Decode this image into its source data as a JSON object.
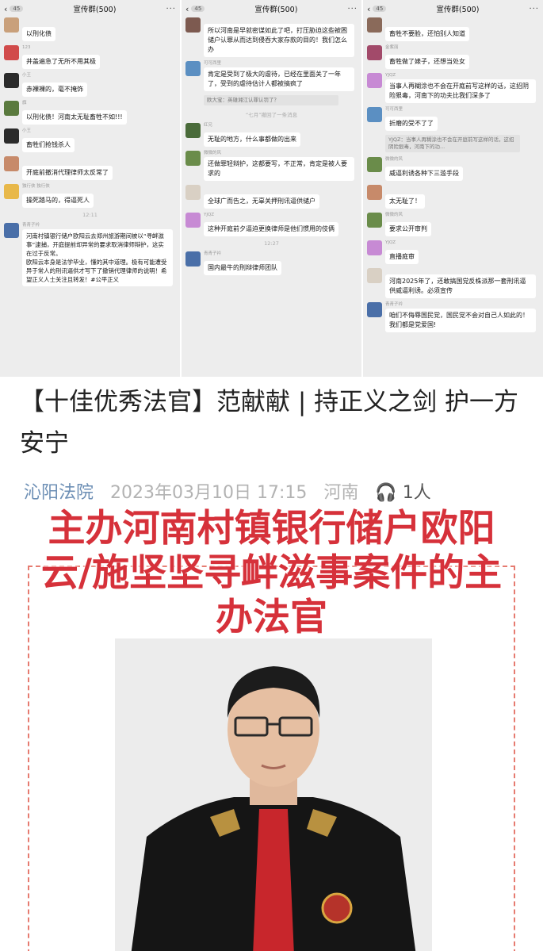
{
  "panels": [
    {
      "unread": "45",
      "group_title": "宣传群(500)",
      "messages": [
        {
          "sender": "",
          "text": "以刑化债",
          "avatar": "#c9a07b"
        },
        {
          "sender": "123",
          "text": "井盖遍急了无所不用其极",
          "avatar": "#d14b4b"
        },
        {
          "sender": "小王",
          "text": "赤裸裸的，毫不掩饰",
          "avatar": "#2b2b2b"
        },
        {
          "sender": "旗",
          "text": "以刑化债！河南太无耻畜牲不如!!!",
          "avatar": "#5a7a3e"
        },
        {
          "sender": "小王",
          "text": "畜牲们抢钱杀人",
          "avatar": "#2b2b2b"
        },
        {
          "sender": "",
          "text": "开庭前撤消代理律师太反常了",
          "avatar": "#c78a6a"
        },
        {
          "sender": "独行侠 独行侠",
          "text": "操死踏马的，得逼死人",
          "avatar": "#e8b84a"
        }
      ],
      "time": "12:11",
      "long_sender": "青青子衿",
      "long_text": "河南村镇银行储户欧阳云去郑州旅游期间被以“寻衅滋事”逮捕，开庭提前却异常的要求取消律师辩护，这实在过于反常。\n欧阳云本身是法学毕业，懂的其中道理。极有可能遭受异于常人的刑讯逼供才写下了撤销代理律师的说明！希望正义人士关注且转发！#公平正义",
      "long_avatar": "#4a6fa8"
    },
    {
      "unread": "45",
      "group_title": "宣传群(500)",
      "messages": [
        {
          "sender": "",
          "text": "所以河南是早就密谋如此了吧，打压胁迫这些被困储户认罪从而达到侵吞大家存款的目的！我们怎么办",
          "avatar": "#7d5a50"
        },
        {
          "sender": "可可西里",
          "text": "肯定是受到了极大的虐待，已经在里面关了一年了，受到的虐待估计人都被搞疯了",
          "avatar": "#5b8fc2"
        }
      ],
      "quote": "欧大宝：英雄湘江认罪认罚了？",
      "recall": "“七月”撤回了一条消息",
      "messages2": [
        {
          "sender": "红兄",
          "text": "无耻的地方，什么事都做的出来",
          "avatar": "#4a6b3a"
        },
        {
          "sender": "微微的风",
          "text": "还做罪轻辩护，这都要写，不正常，肯定是被人要求的",
          "avatar": "#6a8c4a"
        },
        {
          "sender": "",
          "text": "全球广而告之，无辜关押刑讯逼供储户",
          "avatar": "#d9d0c4"
        },
        {
          "sender": "YJQZ",
          "text": "这种开庭前夕逼迫更换律师是他们惯用的伎俩",
          "avatar": "#c78ad4"
        }
      ],
      "time": "12:27",
      "last_sender": "青青子衿",
      "last_text": "国内最牛的刑辩律师团队",
      "last_avatar": "#4a6fa8"
    },
    {
      "unread": "45",
      "group_title": "宣传群(500)",
      "messages": [
        {
          "sender": "",
          "text": "畜牲不要脸，还怕别人知道",
          "avatar": "#8a6a5a"
        },
        {
          "sender": "金紫丽",
          "text": "畜牲做了婊子，还想当处女",
          "avatar": "#a24a6a"
        },
        {
          "sender": "YJQZ",
          "text": "当事人再糊涂也不会在开庭前写这样的话，这招阴险狠毒，河南下的功夫比我们深多了",
          "avatar": "#c78ad4"
        },
        {
          "sender": "可可西里",
          "text": "折磨的受不了了",
          "avatar": "#5b8fc2"
        }
      ],
      "quote": "YJQZ：当事人再糊涂也不会在开庭前写这样的话，这招阴险狠毒，河南下的功...",
      "messages2": [
        {
          "sender": "微微的风",
          "text": "威逼利诱各种下三滥手段",
          "avatar": "#6a8c4a"
        },
        {
          "sender": "",
          "text": "太无耻了！",
          "avatar": "#c78a6a"
        },
        {
          "sender": "微微的风",
          "text": "要求公开审判",
          "avatar": "#6a8c4a"
        },
        {
          "sender": "YJQZ",
          "text": "直播庭审",
          "avatar": "#c78ad4"
        },
        {
          "sender": "",
          "text": "河南2025年了，还敢搞国党反株派那一套刑讯逼供威逼利诱。必须宣传",
          "avatar": "#d9d0c4"
        },
        {
          "sender": "青青子衿",
          "text": "咱们不侮辱国民党，国民党不会对自己人如此的！我们都是党爱国!",
          "avatar": "#4a6fa8"
        }
      ]
    }
  ],
  "article": {
    "title": "【十佳优秀法官】范献献 | 持正义之剑 护一方安宁",
    "source": "沁阳法院",
    "datetime": "2023年03月10日 17:15",
    "region": "河南",
    "listen_icon": "headphone-icon",
    "listeners": "1人",
    "overlay_text": "主办河南村镇银行储户欧阳云/施坚坚寻衅滋事案件的主办法官"
  },
  "colors": {
    "chat_bg": "#ededed",
    "bubble": "#ffffff",
    "overlay_red": "#d6313a",
    "source_blue": "#6d8fb5"
  }
}
